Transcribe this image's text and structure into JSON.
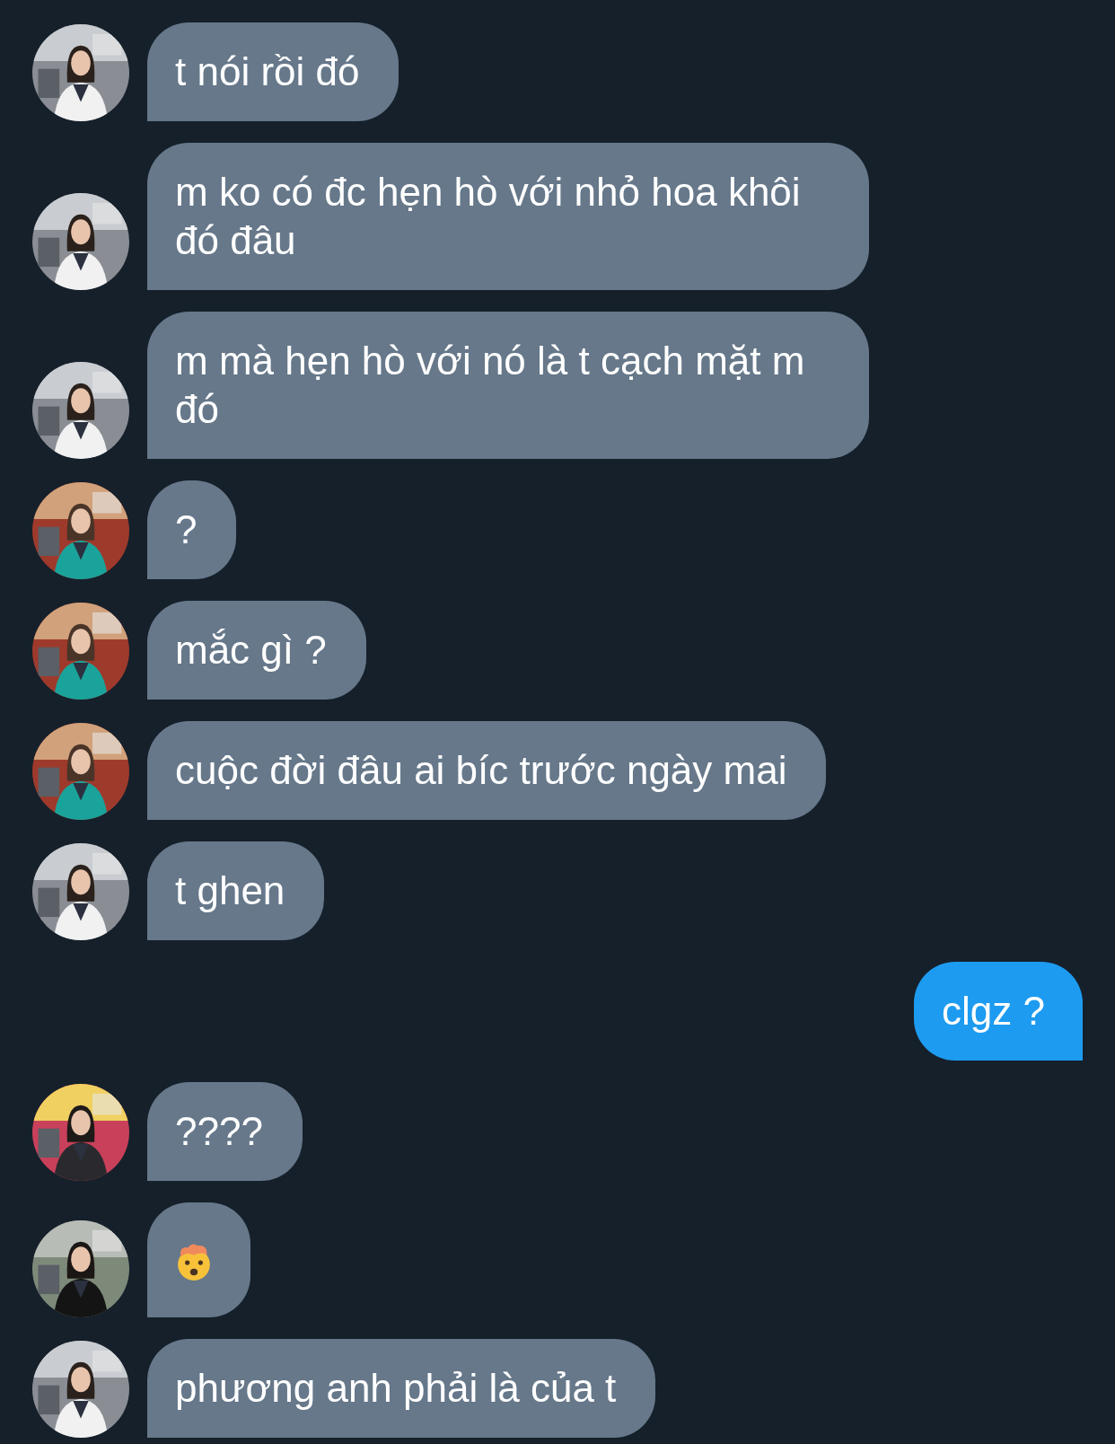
{
  "messages": [
    {
      "kind": "text",
      "outgoing": false,
      "text": "t nói rồi đó"
    },
    {
      "kind": "text",
      "outgoing": false,
      "text": "m ko có đc hẹn hò với nhỏ hoa khôi đó đâu"
    },
    {
      "kind": "text",
      "outgoing": false,
      "text": "m mà hẹn hò với nó là t cạch mặt m đó"
    },
    {
      "kind": "text",
      "outgoing": false,
      "text": "?"
    },
    {
      "kind": "text",
      "outgoing": false,
      "text": "mắc gì ?"
    },
    {
      "kind": "text",
      "outgoing": false,
      "text": "cuộc đời đâu ai bíc trước ngày mai"
    },
    {
      "kind": "text",
      "outgoing": false,
      "text": "t ghen"
    },
    {
      "kind": "text",
      "outgoing": true,
      "text": "clgz ?"
    },
    {
      "kind": "text",
      "outgoing": false,
      "text": "????"
    },
    {
      "kind": "emoji",
      "outgoing": false
    },
    {
      "kind": "text",
      "outgoing": false,
      "text": "phương anh phải là của t"
    }
  ]
}
